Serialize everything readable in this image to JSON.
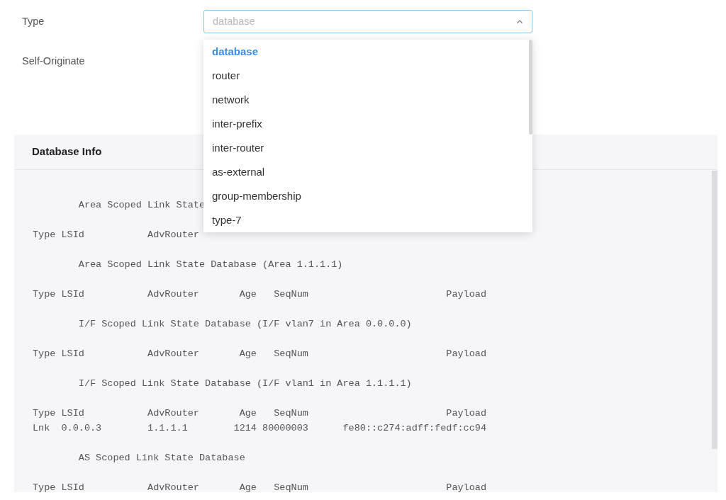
{
  "type_field": {
    "label": "Type",
    "placeholder": "database",
    "expanded": true,
    "options": [
      {
        "label": "database",
        "selected": true
      },
      {
        "label": "router",
        "selected": false
      },
      {
        "label": "network",
        "selected": false
      },
      {
        "label": "inter-prefix",
        "selected": false
      },
      {
        "label": "inter-router",
        "selected": false
      },
      {
        "label": "as-external",
        "selected": false
      },
      {
        "label": "group-membership",
        "selected": false
      },
      {
        "label": "type-7",
        "selected": false
      }
    ]
  },
  "self_originate_label": "Self-Originate",
  "database_info": {
    "title": "Database Info",
    "blocks": [
      {
        "heading": "        Area Scoped Link State",
        "header": "Type LSId           AdvRouter"
      },
      {
        "heading": "        Area Scoped Link State Database (Area 1.1.1.1)",
        "header": "Type LSId           AdvRouter       Age   SeqNum                        Payload"
      },
      {
        "heading": "        I/F Scoped Link State Database (I/F vlan7 in Area 0.0.0.0)",
        "header": "Type LSId           AdvRouter       Age   SeqNum                        Payload"
      },
      {
        "heading": "        I/F Scoped Link State Database (I/F vlan1 in Area 1.1.1.1)",
        "header": "Type LSId           AdvRouter       Age   SeqNum                        Payload",
        "rows": [
          "Lnk  0.0.0.3        1.1.1.1        1214 80000003      fe80::c274:adff:fedf:cc94"
        ]
      },
      {
        "heading": "        AS Scoped Link State Database",
        "header": "Type LSId           AdvRouter       Age   SeqNum                        Payload"
      }
    ]
  }
}
